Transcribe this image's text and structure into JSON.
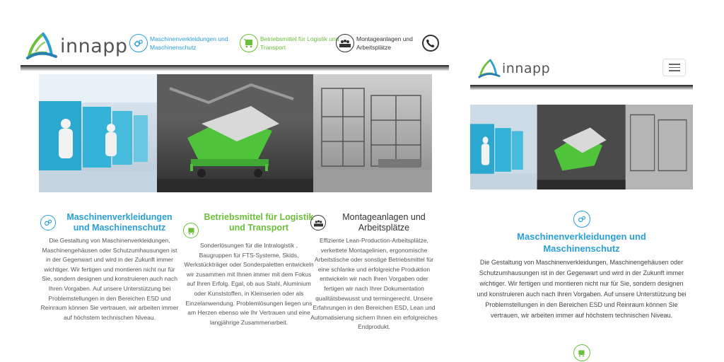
{
  "brand": {
    "name": "innapp"
  },
  "colors": {
    "blue": "#2a9fd6",
    "green": "#6cbf3a",
    "dark": "#333333"
  },
  "nav": [
    {
      "label": "Maschinenverkleidungen und Maschinenschutz",
      "icon": "gear-cog-icon",
      "color": "blue"
    },
    {
      "label": "Betriebsmittel für Logistik und Transport",
      "icon": "cart-icon",
      "color": "green"
    },
    {
      "label": "Montageanlagen und Arbeitsplätze",
      "icon": "workers-icon",
      "color": "dark"
    }
  ],
  "contact": {
    "icon": "phone-icon"
  },
  "sections": [
    {
      "title": "Maschinenverkleidungen und Maschinenschutz",
      "text": "Die Gestaltung von Maschinenverkleidungen, Maschinengehäusen oder Schutzumhausungen ist in der Gegenwart und wird in der Zukunft immer wichtiger. Wir fertigen und montieren nicht nur für Sie, sondern designen und konstruieren auch nach Ihren Vorgaben. Auf unsere Unterstützung bei Problemstellungen in den Bereichen ESD und Reinraum können Sie vertrauen, wir arbeiten immer auf höchstem technischen Niveau."
    },
    {
      "title": "Betriebsmittel für Logistik und Transport",
      "text": "Sonderlösungen für die Intralogistik , Baugruppen für FTS-Systeme, Skids, Werkstückträger oder Sonderpaletten entwickeln wir zusammen mit Ihnen immer mit dem Fokus auf Ihren Erfolg. Egal, ob aus Stahl, Aluminium oder Kunststoffen, in Kleinserien oder als Einzelanwendung. Problemlösungen liegen uns am Herzen ebenso wie Ihr Vertrauen und eine langjährige Zusammenarbeit."
    },
    {
      "title": "Montageanlagen und Arbeitsplätze",
      "text": "Effiziente Lean-Production-Arbeitsplätze, verkettete Montagelinien, ergonomische Arbeitstische oder sonstige Betriebsmittel für eine schlanke und erfolgreiche Produktion entwickeln wir nach Ihren Vorgaben oder fertigen wir nach Ihrer Dokumentation qualitätsbewusst und termingerecht. Unsere Erfahrungen in den Bereichen ESD, Lean und Automatisierung sichern Ihnen ein erfolgreiches Endprodukt."
    }
  ]
}
